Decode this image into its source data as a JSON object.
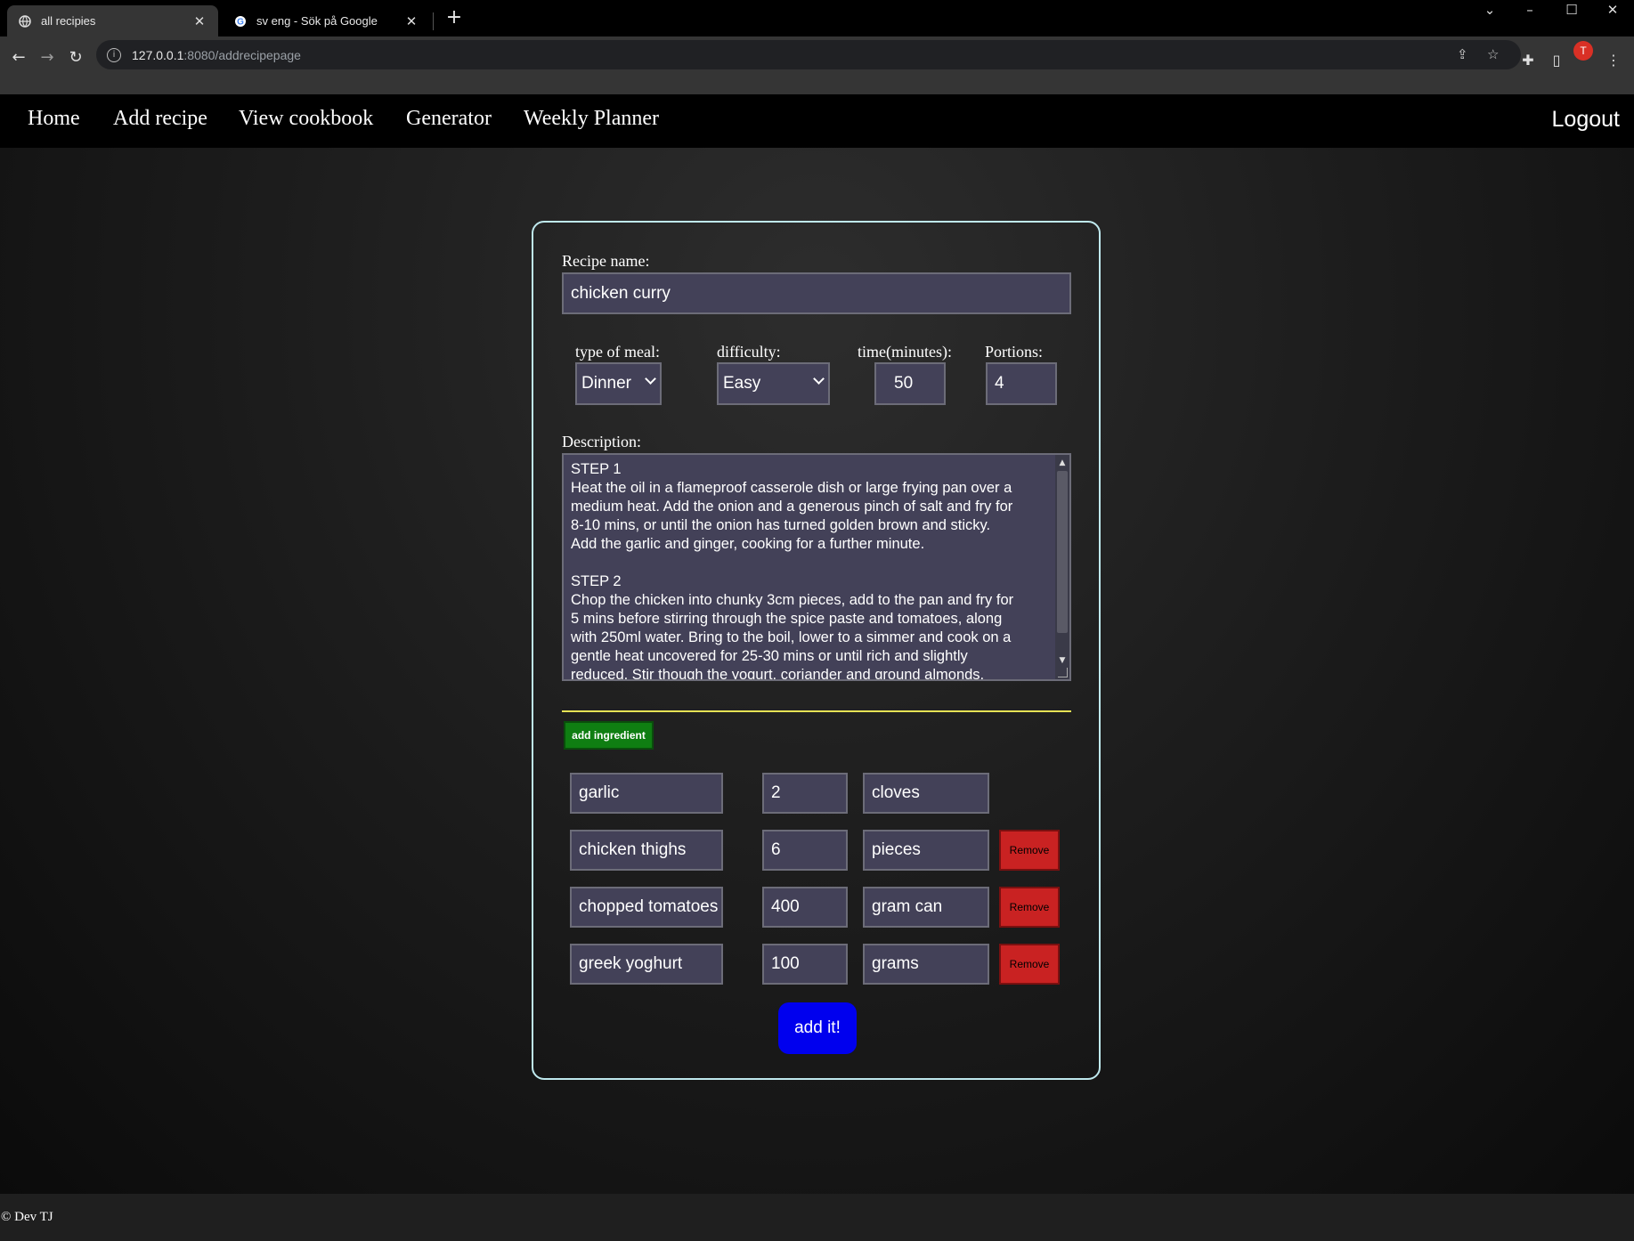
{
  "browser": {
    "tabs": [
      {
        "title": "all recipies",
        "active": true
      },
      {
        "title": "sv eng - Sök på Google",
        "active": false
      }
    ],
    "url_host": "127.0.0.1",
    "url_rest": ":8080/addrecipepage",
    "profile_initial": "T"
  },
  "nav": {
    "links": [
      "Home",
      "Add recipe",
      "View cookbook",
      "Generator",
      "Weekly Planner"
    ],
    "logout": "Logout"
  },
  "form": {
    "recipe_name_label": "Recipe name:",
    "recipe_name_value": "chicken curry",
    "meal_type_label": "type of meal:",
    "meal_type_value": "Dinner",
    "difficulty_label": "difficulty:",
    "difficulty_value": "Easy",
    "time_label": "time(minutes):",
    "time_value": "50",
    "portions_label": "Portions:",
    "portions_value": "4",
    "description_label": "Description:",
    "description_lines": [
      "STEP 1",
      "Heat the oil in a flameproof casserole dish or large frying pan over a",
      "medium heat. Add the onion and a generous pinch of salt and fry for",
      "8-10 mins, or until the onion has turned golden brown and sticky.",
      "Add the garlic and ginger, cooking for a further minute.",
      "",
      "STEP 2",
      "Chop the chicken into chunky 3cm pieces, add to the pan and fry for",
      "5 mins before stirring through the spice paste and tomatoes, along",
      "with 250ml water. Bring to the boil, lower to a simmer and cook on a",
      "gentle heat uncovered for 25-30 mins or until rich and slightly",
      "reduced. Stir though the yogurt, coriander and ground almonds,"
    ],
    "add_ingredient_label": "add ingredient",
    "ingredients": [
      {
        "name": "garlic",
        "amount": "2",
        "unit": "cloves",
        "removable": false
      },
      {
        "name": "chicken thighs",
        "amount": "6",
        "unit": "pieces",
        "removable": true
      },
      {
        "name": "chopped tomatoes",
        "amount": "400",
        "unit": "gram can",
        "removable": true
      },
      {
        "name": "greek yoghurt",
        "amount": "100",
        "unit": "grams",
        "removable": true
      }
    ],
    "remove_label": "Remove",
    "submit_label": "add it!"
  },
  "footer": {
    "text": "© Dev TJ"
  },
  "colors": {
    "accent_border": "#bfe9ee",
    "divider": "#e6e255",
    "add_ingredient": "#0f7e12",
    "remove": "#c92222",
    "submit": "#0000ee",
    "field_bg": "#434158"
  }
}
